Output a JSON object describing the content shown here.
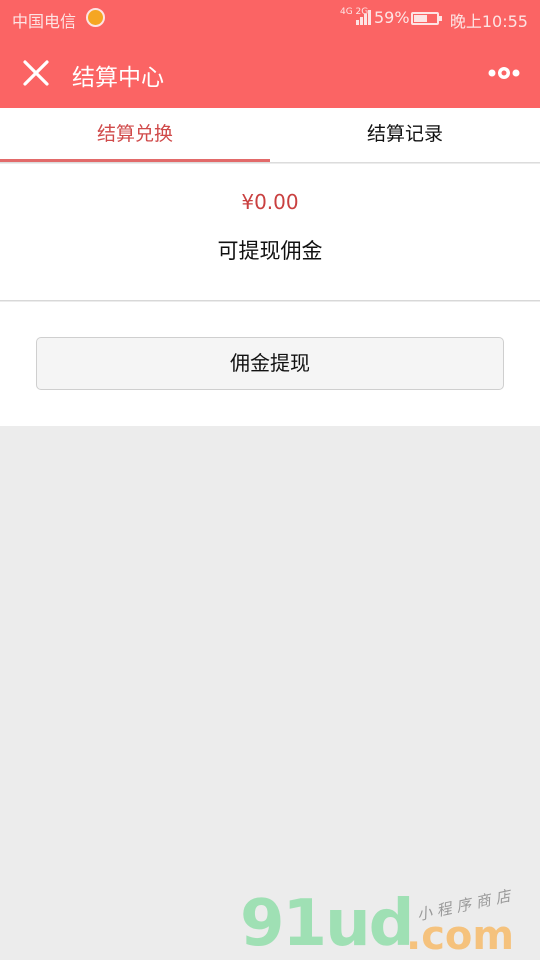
{
  "status_bar": {
    "carrier": "中国电信",
    "network": "4G 2G",
    "battery": "59%",
    "battery_level": 0.59,
    "time": "晚上10:55"
  },
  "nav": {
    "title": "结算中心",
    "close_icon": "close-icon",
    "more_icon": "more-icon"
  },
  "tabs": [
    {
      "label": "结算兑换",
      "active": true
    },
    {
      "label": "结算记录",
      "active": false
    }
  ],
  "balance": {
    "amount": "¥0.00",
    "label": "可提现佣金"
  },
  "withdraw_button": "佣金提现",
  "watermark": {
    "brand": "91ud",
    "domain": ".com",
    "tagline": "小程序商店"
  },
  "colors": {
    "header": "#fb6464",
    "accent": "#d04a4a",
    "background": "#ececec"
  }
}
